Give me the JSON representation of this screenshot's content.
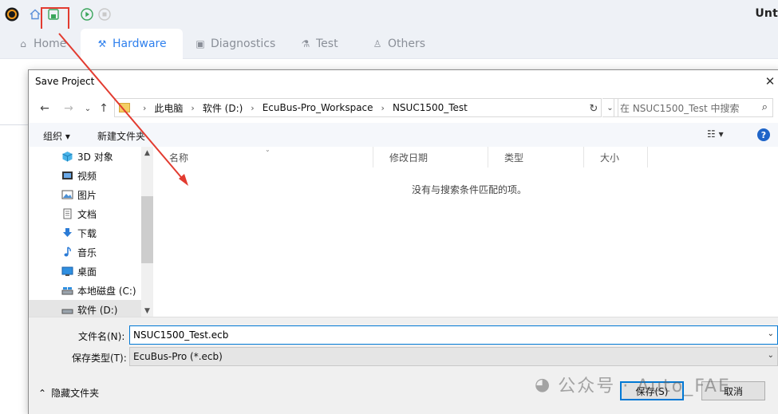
{
  "app": {
    "title": "Unt",
    "tabs": [
      {
        "label": "Home",
        "icon": "home-icon"
      },
      {
        "label": "Hardware",
        "icon": "hardware-icon",
        "active": true
      },
      {
        "label": "Diagnostics",
        "icon": "diagnostics-icon"
      },
      {
        "label": "Test",
        "icon": "flask-icon"
      },
      {
        "label": "Others",
        "icon": "user-icon"
      }
    ],
    "accent_color": "#2f80ed",
    "highlight_color": "#e23b30"
  },
  "dialog": {
    "title": "Save Project",
    "breadcrumb": [
      "此电脑",
      "软件 (D:)",
      "EcuBus-Pro_Workspace",
      "NSUC1500_Test"
    ],
    "search_placeholder": "在 NSUC1500_Test 中搜索",
    "organize_label": "组织 ▾",
    "new_folder_label": "新建文件夹",
    "help_label": "?",
    "nav_items": [
      {
        "label": "3D 对象",
        "icon": "3d-objects-icon"
      },
      {
        "label": "视频",
        "icon": "videos-icon"
      },
      {
        "label": "图片",
        "icon": "pictures-icon"
      },
      {
        "label": "文档",
        "icon": "documents-icon"
      },
      {
        "label": "下载",
        "icon": "downloads-icon"
      },
      {
        "label": "音乐",
        "icon": "music-icon"
      },
      {
        "label": "桌面",
        "icon": "desktop-icon"
      },
      {
        "label": "本地磁盘 (C:)",
        "icon": "drive-icon"
      },
      {
        "label": "软件 (D:)",
        "icon": "drive-icon",
        "selected": true
      }
    ],
    "columns": [
      "名称",
      "修改日期",
      "类型",
      "大小"
    ],
    "empty_message": "没有与搜索条件匹配的项。",
    "filename_label": "文件名(N):",
    "filename_value": "NSUC1500_Test.ecb",
    "filetype_label": "保存类型(T):",
    "filetype_value": "EcuBus-Pro (*.ecb)",
    "hide_folders_label": "隐藏文件夹",
    "save_label": "保存(S)",
    "cancel_label": "取消"
  },
  "watermark": "公众号 · Auto_FAE"
}
